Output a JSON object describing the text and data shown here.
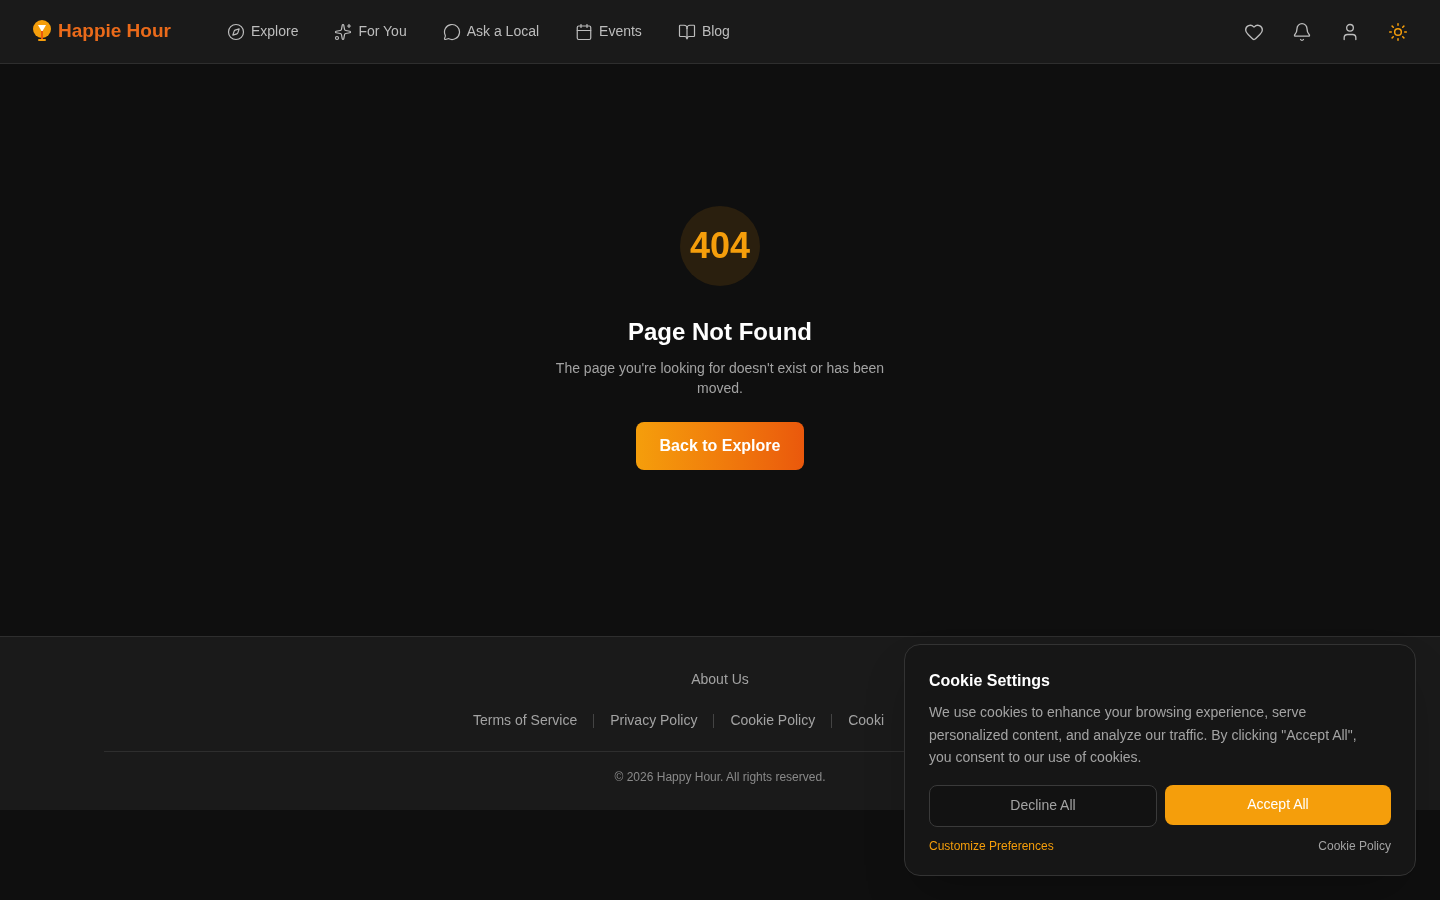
{
  "header": {
    "logo": "Happie Hour",
    "nav": [
      {
        "label": "Explore"
      },
      {
        "label": "For You"
      },
      {
        "label": "Ask a Local"
      },
      {
        "label": "Events"
      },
      {
        "label": "Blog"
      }
    ]
  },
  "error": {
    "code": "404",
    "title": "Page Not Found",
    "message": "The page you're looking for doesn't exist or has been moved.",
    "button": "Back to Explore"
  },
  "footer": {
    "about": "About Us",
    "links": [
      "Terms of Service",
      "Privacy Policy",
      "Cookie Policy",
      "Cooki"
    ],
    "copyright": "© 2026 Happy Hour. All rights reserved."
  },
  "cookie_banner": {
    "title": "Cookie Settings",
    "text": "We use cookies to enhance your browsing experience, serve personalized content, and analyze our traffic. By clicking \"Accept All\", you consent to our use of cookies.",
    "decline": "Decline All",
    "accept": "Accept All",
    "customize": "Customize Preferences",
    "policy": "Cookie Policy"
  }
}
